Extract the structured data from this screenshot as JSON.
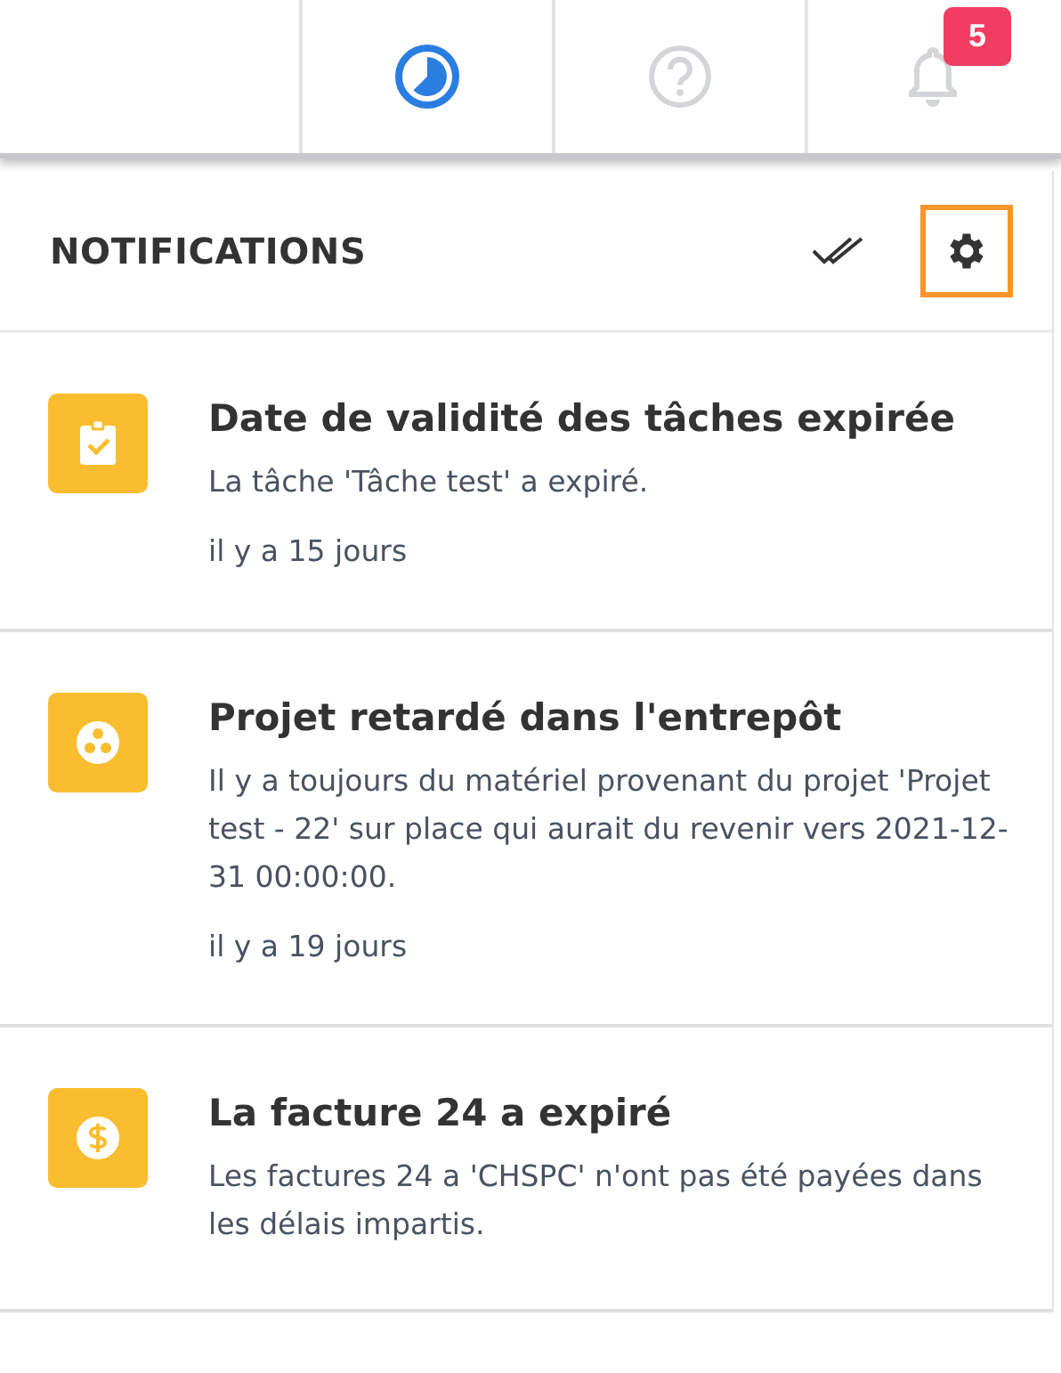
{
  "top_bar": {
    "tools": [
      {
        "kind": "timer",
        "active": true
      },
      {
        "kind": "help",
        "active": false
      },
      {
        "kind": "bell",
        "active": false,
        "badge": "5"
      }
    ]
  },
  "panel": {
    "title": "NOTIFICATIONS",
    "settings_highlighted": true
  },
  "notifications": [
    {
      "kind": "task",
      "title": "Date de validité des tâches expirée",
      "description": "La tâche 'Tâche test' a expiré.",
      "time": "il y a 15 jours"
    },
    {
      "kind": "project",
      "title": "Projet retardé dans l'entrepôt",
      "description": "Il y a toujours du matériel provenant du projet 'Projet test - 22' sur place qui aurait du revenir vers 2021-12-31 00:00:00.",
      "time": "il y a 19 jours"
    },
    {
      "kind": "invoice",
      "title": "La facture 24 a expiré",
      "description": "Les factures 24 a 'CHSPC' n'ont pas été payées dans les délais impartis."
    }
  ]
}
